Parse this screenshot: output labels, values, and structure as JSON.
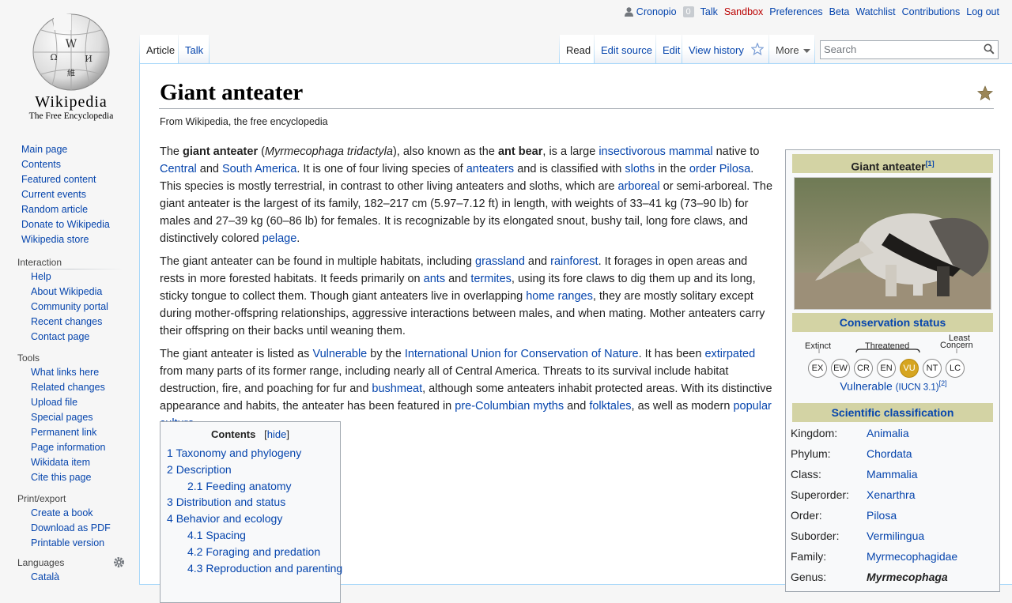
{
  "personal": {
    "username": "Cronopio",
    "notifications": "0",
    "talk": "Talk",
    "sandbox": "Sandbox",
    "preferences": "Preferences",
    "beta": "Beta",
    "watchlist": "Watchlist",
    "contributions": "Contributions",
    "logout": "Log out"
  },
  "logo": {
    "wordmark": "Wikipedia",
    "tagline": "The Free Encyclopedia"
  },
  "nav": [
    "Main page",
    "Contents",
    "Featured content",
    "Current events",
    "Random article",
    "Donate to Wikipedia",
    "Wikipedia store"
  ],
  "interaction": {
    "heading": "Interaction",
    "items": [
      "Help",
      "About Wikipedia",
      "Community portal",
      "Recent changes",
      "Contact page"
    ]
  },
  "tools": {
    "heading": "Tools",
    "items": [
      "What links here",
      "Related changes",
      "Upload file",
      "Special pages",
      "Permanent link",
      "Page information",
      "Wikidata item",
      "Cite this page"
    ]
  },
  "print": {
    "heading": "Print/export",
    "items": [
      "Create a book",
      "Download as PDF",
      "Printable version"
    ]
  },
  "languages": {
    "heading": "Languages",
    "partial": "Català"
  },
  "tabs": {
    "article": "Article",
    "talk": "Talk",
    "read": "Read",
    "edit_source": "Edit source",
    "edit": "Edit",
    "history": "View history",
    "more": "More"
  },
  "search": {
    "placeholder": "Search"
  },
  "article": {
    "title": "Giant anteater",
    "from": "From Wikipedia, the free encyclopedia",
    "p1": [
      {
        "t": "The "
      },
      {
        "t": "giant anteater",
        "b": 1
      },
      {
        "t": " ("
      },
      {
        "t": "Myrmecophaga tridactyla",
        "i": 1
      },
      {
        "t": "), also known as the "
      },
      {
        "t": "ant bear",
        "b": 1
      },
      {
        "t": ", is a large "
      },
      {
        "t": "insectivorous",
        "l": 1
      },
      {
        "t": " "
      },
      {
        "t": "mammal",
        "l": 1
      },
      {
        "t": " native to "
      },
      {
        "t": "Central",
        "l": 1
      },
      {
        "t": " and "
      },
      {
        "t": "South America",
        "l": 1
      },
      {
        "t": ". It is one of four living species of "
      },
      {
        "t": "anteaters",
        "l": 1
      },
      {
        "t": " and is classified with "
      },
      {
        "t": "sloths",
        "l": 1
      },
      {
        "t": " in the "
      },
      {
        "t": "order",
        "l": 1
      },
      {
        "t": " "
      },
      {
        "t": "Pilosa",
        "l": 1
      },
      {
        "t": ". This species is mostly terrestrial, in contrast to other living anteaters and sloths, which are "
      },
      {
        "t": "arboreal",
        "l": 1
      },
      {
        "t": " or semi-arboreal. The giant anteater is the largest of its family, 182–217 cm (5.97–7.12 ft) in length, with weights of 33–41 kg (73–90 lb) for males and 27–39 kg (60–86 lb) for females. It is recognizable by its elongated snout, bushy tail, long fore claws, and distinctively colored "
      },
      {
        "t": "pelage",
        "l": 1
      },
      {
        "t": "."
      }
    ],
    "p2": [
      {
        "t": "The giant anteater can be found in multiple habitats, including "
      },
      {
        "t": "grassland",
        "l": 1
      },
      {
        "t": " and "
      },
      {
        "t": "rainforest",
        "l": 1
      },
      {
        "t": ". It forages in open areas and rests in more forested habitats. It feeds primarily on "
      },
      {
        "t": "ants",
        "l": 1
      },
      {
        "t": " and "
      },
      {
        "t": "termites",
        "l": 1
      },
      {
        "t": ", using its fore claws to dig them up and its long, sticky tongue to collect them. Though giant anteaters live in overlapping "
      },
      {
        "t": "home ranges",
        "l": 1
      },
      {
        "t": ", they are mostly solitary except during mother-offspring relationships, aggressive interactions between males, and when mating. Mother anteaters carry their offspring on their backs until weaning them."
      }
    ],
    "p3": [
      {
        "t": "The giant anteater is listed as "
      },
      {
        "t": "Vulnerable",
        "l": 1
      },
      {
        "t": " by the "
      },
      {
        "t": "International Union for Conservation of Nature",
        "l": 1
      },
      {
        "t": ". It has been "
      },
      {
        "t": "extirpated",
        "l": 1
      },
      {
        "t": " from many parts of its former range, including nearly all of Central America. Threats to its survival include habitat destruction, fire, and poaching for fur and "
      },
      {
        "t": "bushmeat",
        "l": 1
      },
      {
        "t": ", although some anteaters inhabit protected areas. With its distinctive appearance and habits, the anteater has been featured in "
      },
      {
        "t": "pre-Columbian",
        "l": 1
      },
      {
        "t": " "
      },
      {
        "t": "myths",
        "l": 1
      },
      {
        "t": " and "
      },
      {
        "t": "folktales",
        "l": 1
      },
      {
        "t": ", as well as modern "
      },
      {
        "t": "popular culture",
        "l": 1
      },
      {
        "t": "."
      }
    ]
  },
  "toc": {
    "title": "Contents",
    "hide": "hide",
    "items": [
      {
        "n": "1",
        "t": "Taxonomy and phylogeny",
        "lvl": 1
      },
      {
        "n": "2",
        "t": "Description",
        "lvl": 1
      },
      {
        "n": "2.1",
        "t": "Feeding anatomy",
        "lvl": 2
      },
      {
        "n": "3",
        "t": "Distribution and status",
        "lvl": 1
      },
      {
        "n": "4",
        "t": "Behavior and ecology",
        "lvl": 1
      },
      {
        "n": "4.1",
        "t": "Spacing",
        "lvl": 2
      },
      {
        "n": "4.2",
        "t": "Foraging and predation",
        "lvl": 2
      },
      {
        "n": "4.3",
        "t": "Reproduction and parenting",
        "lvl": 2
      }
    ]
  },
  "infobox": {
    "title": "Giant anteater",
    "title_ref": "[1]",
    "conservation_heading": "Conservation status",
    "extinct": "Extinct",
    "threatened": "Threatened",
    "least": "Least",
    "concern": "Concern",
    "codes": [
      "EX",
      "EW",
      "CR",
      "EN",
      "VU",
      "NT",
      "LC"
    ],
    "selected_code": "VU",
    "status": "Vulnerable",
    "status_src": "(IUCN 3.1)",
    "status_ref": "[2]",
    "classification_heading": "Scientific classification",
    "taxonomy": [
      {
        "k": "Kingdom:",
        "v": "Animalia"
      },
      {
        "k": "Phylum:",
        "v": "Chordata"
      },
      {
        "k": "Class:",
        "v": "Mammalia"
      },
      {
        "k": "Superorder:",
        "v": "Xenarthra"
      },
      {
        "k": "Order:",
        "v": "Pilosa"
      },
      {
        "k": "Suborder:",
        "v": "Vermilingua"
      },
      {
        "k": "Family:",
        "v": "Myrmecophagidae"
      },
      {
        "k": "Genus:",
        "v": "Myrmecophaga"
      }
    ]
  },
  "colors": {
    "link": "#0645ad",
    "redlink": "#ba0000",
    "infobox_header": "#d3d3a4",
    "vu": "#d6a520"
  }
}
